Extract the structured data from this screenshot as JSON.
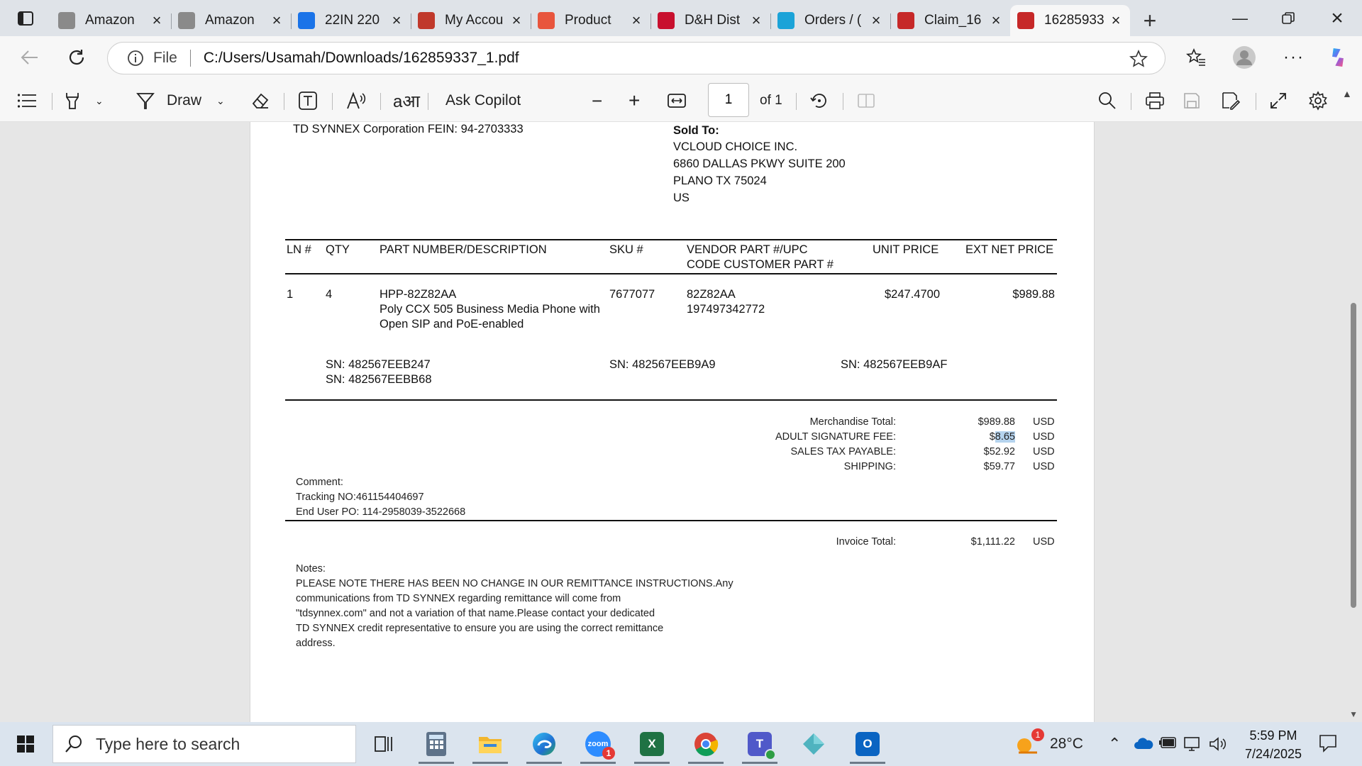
{
  "browser": {
    "tabs": [
      {
        "title": "Amazon",
        "icon": "amazon-icon",
        "color": "#8a8a8a"
      },
      {
        "title": "Amazon",
        "icon": "amazon-icon",
        "color": "#8a8a8a"
      },
      {
        "title": "22IN 220",
        "icon": "site-icon",
        "color": "#1a73e8"
      },
      {
        "title": "My Accou",
        "icon": "account-icon",
        "color": "#c0392b"
      },
      {
        "title": "Product",
        "icon": "product-icon",
        "color": "#e8553d"
      },
      {
        "title": "D&H Dist",
        "icon": "dh-icon",
        "color": "#c8102e"
      },
      {
        "title": "Orders / (",
        "icon": "ec-icon",
        "color": "#1ba3d8"
      },
      {
        "title": "Claim_16",
        "icon": "pdf-icon",
        "color": "#c62828"
      },
      {
        "title": "16285933",
        "icon": "pdf-icon",
        "color": "#c62828"
      }
    ],
    "url_scheme": "File",
    "url": "C:/Users/Usamah/Downloads/162859337_1.pdf"
  },
  "pdf_toolbar": {
    "draw_label": "Draw",
    "copilot_label": "Ask Copilot",
    "page_number": "1",
    "page_of": "of 1"
  },
  "invoice": {
    "company_fein": "TD SYNNEX Corporation FEIN: 94-2703333",
    "sold_to_label": "Sold To:",
    "sold_to_lines": [
      "VCLOUD CHOICE INC.",
      "6860 DALLAS PKWY SUITE 200",
      "PLANO TX 75024",
      "US"
    ],
    "columns": {
      "ln": "LN #",
      "qty": "QTY",
      "part": "PART NUMBER/DESCRIPTION",
      "sku": "SKU #",
      "vendor_1": "VENDOR PART #/UPC",
      "vendor_2": "CODE CUSTOMER PART #",
      "unit_price": "UNIT PRICE",
      "ext_price": "EXT NET PRICE"
    },
    "line": {
      "ln": "1",
      "qty": "4",
      "part_number": "HPP-82Z82AA",
      "description_1": "Poly CCX 505 Business Media Phone with",
      "description_2": "Open SIP and PoE-enabled",
      "sku": "7677077",
      "vendor_part": "82Z82AA",
      "upc": "197497342772",
      "unit_price": "$247.4700",
      "ext_price": "$989.88"
    },
    "serials": [
      "SN: 482567EEB247",
      "SN: 482567EEBB68",
      "SN: 482567EEB9A9",
      "SN: 482567EEB9AF"
    ],
    "totals": [
      {
        "label": "Merchandise Total:",
        "amount": "$989.88",
        "currency": "USD"
      },
      {
        "label": "ADULT SIGNATURE FEE:",
        "amount_pre": "$",
        "amount_sel": "8.65",
        "currency": "USD"
      },
      {
        "label": "SALES TAX PAYABLE:",
        "amount": "$52.92",
        "currency": "USD"
      },
      {
        "label": "SHIPPING:",
        "amount": "$59.77",
        "currency": "USD"
      }
    ],
    "comment_label": "Comment:",
    "tracking": "Tracking NO:461154404697",
    "end_user_po": "End User PO: 114-2958039-3522668",
    "invoice_total_label": "Invoice Total:",
    "invoice_total": "$1,111.22",
    "invoice_total_currency": "USD",
    "notes_label": "Notes:",
    "notes_lines": [
      "PLEASE NOTE THERE HAS BEEN NO CHANGE IN OUR REMITTANCE INSTRUCTIONS.Any",
      "communications from TD SYNNEX regarding remittance will come from",
      "\"tdsynnex.com\" and not a variation of that name.Please contact your dedicated",
      "TD SYNNEX credit representative to ensure you are using the correct remittance",
      "address."
    ]
  },
  "taskbar": {
    "search_placeholder": "Type here to search",
    "zoom_badge": "1",
    "weather_badge": "1",
    "temperature": "28°C",
    "time": "5:59 PM",
    "date": "7/24/2025"
  }
}
